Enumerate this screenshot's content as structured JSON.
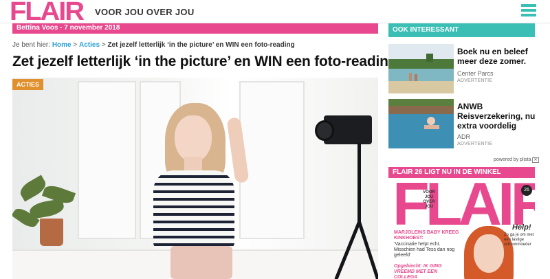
{
  "header": {
    "logo": "FLAIR",
    "tagline": "VOOR JOU OVER JOU",
    "brand_color": "#e8488d",
    "accent_color": "#3bbfb5",
    "menu_icon": "hamburger-icon"
  },
  "article": {
    "author_date": "Bettina Voos - 7 november 2018",
    "breadcrumb": {
      "prefix": "Je bent hier:",
      "home": "Home",
      "sep1": ">",
      "section": "Acties",
      "sep2": ">",
      "current": "Zet jezelf letterlijk ‘in the picture’ en WIN een foto-reading"
    },
    "title": "Zet jezelf letterlijk ‘in the picture’ en WIN een foto-reading",
    "category_tag": "ACTIES",
    "tag_color": "#e0902c"
  },
  "sidebar": {
    "heading": "OOK INTERESSANT",
    "ads": [
      {
        "title": "Boek nu en beleef meer deze zomer.",
        "source": "Center Parcs",
        "label": "ADVERTENTIE"
      },
      {
        "title": "ANWB Reisverzekering, nu extra voordelig",
        "source": "ADR",
        "label": "ADVERTENTIE"
      }
    ],
    "powered_by": "powered by plista",
    "promo": {
      "heading": "FLAIR 26 LIGT NU IN DE WINKEL",
      "cover_logo": "FLAIR",
      "cover_small": "VOOR JOU OVER JOU",
      "cover_issue": "26",
      "cover_headline": "MARJOLEINS BABY KREEG KINKHOEST:",
      "cover_body": "‘Vaccinatie helpt echt. Misschien had Tess dan nog geleefd’",
      "cover_ogeb": "Opgebiecht: IK GING VREEMD MET EEN COLLEGA",
      "cover_help": "Help!",
      "cover_help_sub": "Zo ga je om met een lastige schoonmoeder"
    }
  }
}
